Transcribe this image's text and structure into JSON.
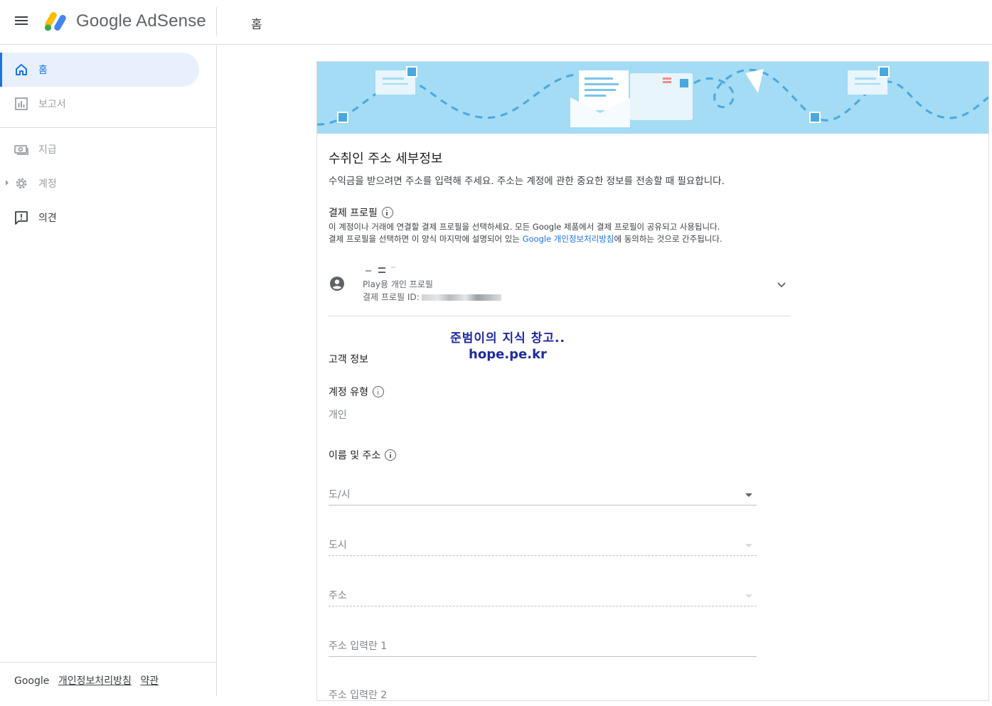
{
  "header": {
    "brand": "Google AdSense",
    "title": "홈"
  },
  "sidebar": {
    "items": [
      {
        "label": "홈",
        "icon": "home-icon",
        "active": true
      },
      {
        "label": "보고서",
        "icon": "report-chart-icon"
      },
      {
        "label": "지급",
        "icon": "payments-icon"
      },
      {
        "label": "계정",
        "icon": "gear-icon"
      },
      {
        "label": "의견",
        "icon": "feedback-icon"
      }
    ],
    "footer": {
      "brand": "Google",
      "privacy": "개인정보처리방침",
      "terms": "약관"
    }
  },
  "form": {
    "title": "수취인 주소 세부정보",
    "description": "수익금을 받으려면 주소를 입력해 주세요. 주소는 계정에 관한 중요한 정보를 전송할 때 필요합니다.",
    "billing_profile": {
      "label": "결제 프로필",
      "desc_line1": "이 계정이나 거래에 연결할 결제 프로필을 선택하세요. 모든 Google 제품에서 결제 프로필이 공유되고 사용됩니다.",
      "desc_line2_before": "결제 프로필을 선택하면 이 양식 마지막에 설명되어 있는 ",
      "desc_line2_link": "Google 개인정보처리방침",
      "desc_line2_after": "에 동의하는 것으로 간주됩니다.",
      "profile_type": "Play용 개인 프로필",
      "profile_id_label": "결제 프로필 ID:"
    },
    "watermark": {
      "line1": "준범이의 지식 창고..",
      "line2": "hope.pe.kr"
    },
    "customer_info_label": "고객 정보",
    "account_type": {
      "label": "계정 유형",
      "value": "개인"
    },
    "name_address_label": "이름 및 주소",
    "fields": {
      "province": "도/시",
      "city": "도시",
      "address": "주소",
      "address_line1": "주소 입력란 1",
      "address_line2": "주소 입력란 2"
    }
  },
  "colors": {
    "accent": "#1a73e8",
    "active_bg": "#e8f0fe",
    "banner": "#a3dcf4",
    "watermark": "#1e2aa0"
  }
}
